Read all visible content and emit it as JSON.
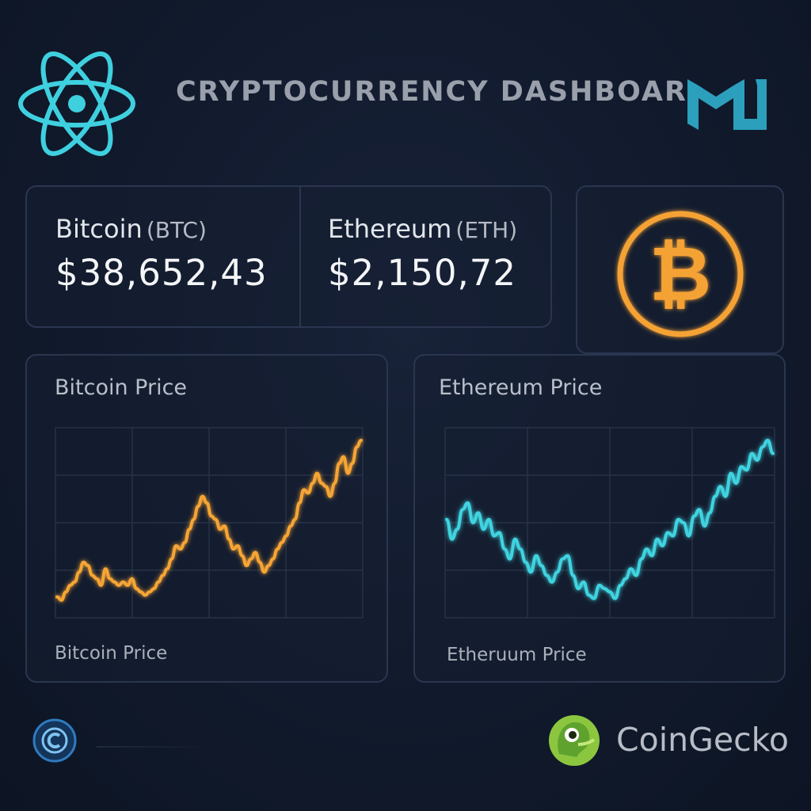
{
  "header": {
    "title": "CRYPTOCURRENCY DASHBOAR",
    "left_logo_icon": "react-atom-icon",
    "right_logo_icon": "mui-logo-icon"
  },
  "prices": {
    "btc": {
      "name": "Bitcoin",
      "symbol": "(BTC)",
      "price": "$38,652,43"
    },
    "eth": {
      "name": "Ethereum",
      "symbol": "(ETH)",
      "price": "$2,150,72"
    },
    "badge_icon": "bitcoin-icon"
  },
  "charts": {
    "btc": {
      "title": "Bitcoin Price",
      "footer": "Bitcoin Price",
      "color": "#f6a535"
    },
    "eth": {
      "title": "Ethereum Price",
      "footer": "Etheruum Price",
      "color": "#3fd3e0"
    }
  },
  "chart_data": [
    {
      "type": "line",
      "title": "Bitcoin Price",
      "xlabel": "Bitcoin Price",
      "ylabel": "",
      "grid": true,
      "ylim": [
        0,
        100
      ],
      "series": [
        {
          "values": [
            5,
            3,
            8,
            12,
            14,
            20,
            26,
            24,
            18,
            16,
            12,
            22,
            16,
            14,
            12,
            14,
            12,
            16,
            10,
            8,
            6,
            8,
            10,
            14,
            18,
            22,
            28,
            36,
            34,
            38,
            46,
            52,
            60,
            66,
            62,
            54,
            52,
            46,
            48,
            40,
            34,
            36,
            30,
            24,
            28,
            32,
            26,
            20,
            24,
            28,
            34,
            38,
            42,
            48,
            52,
            62,
            70,
            68,
            74,
            80,
            74,
            72,
            66,
            74,
            86,
            90,
            80,
            86,
            96,
            100
          ]
        }
      ]
    },
    {
      "type": "line",
      "title": "Ethereum Price",
      "xlabel": "Etheruum Price",
      "ylabel": "",
      "grid": true,
      "ylim": [
        0,
        100
      ],
      "series": [
        {
          "values": [
            52,
            40,
            46,
            58,
            62,
            50,
            56,
            46,
            52,
            42,
            44,
            34,
            28,
            40,
            34,
            26,
            20,
            30,
            24,
            18,
            14,
            20,
            28,
            30,
            18,
            10,
            14,
            6,
            4,
            12,
            10,
            8,
            4,
            12,
            16,
            22,
            18,
            28,
            34,
            30,
            40,
            36,
            44,
            42,
            52,
            50,
            42,
            54,
            58,
            48,
            56,
            66,
            72,
            66,
            80,
            74,
            84,
            82,
            92,
            88,
            96,
            100,
            92
          ]
        }
      ]
    }
  ],
  "footer": {
    "brand": "CoinGecko",
    "left_icon": "copyright-icon",
    "brand_icon": "coingecko-logo-icon"
  }
}
